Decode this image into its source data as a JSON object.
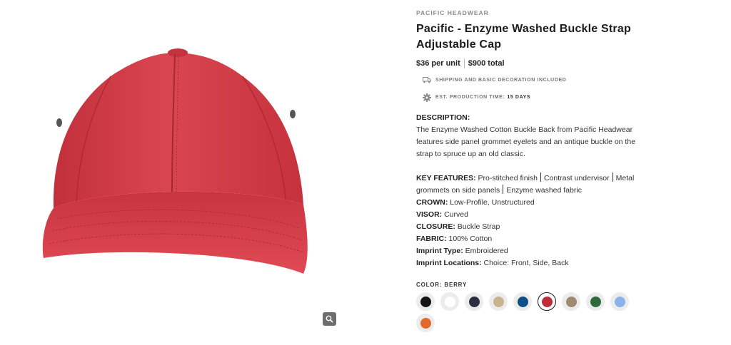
{
  "product": {
    "brand": "PACIFIC HEADWEAR",
    "title": "Pacific - Enzyme Washed Buckle Strap Adjustable Cap",
    "price_per_unit": "$36 per unit",
    "price_total": "$900 total",
    "shipping_note": "SHIPPING AND BASIC DECORATION INCLUDED",
    "production_label": "EST. PRODUCTION TIME:",
    "production_value": "15 DAYS"
  },
  "description": {
    "heading": "DESCRIPTION:",
    "text": "The Enzyme Washed Cotton Buckle Back from Pacific Headwear features side panel grommet eyelets and an antique buckle on the strap to spruce up an old classic."
  },
  "specs": {
    "key_features_label": "KEY FEATURES:",
    "key_features": [
      "Pro-stitched finish",
      "Contrast undervisor",
      "Metal grommets on side panels",
      "Enzyme washed fabric"
    ],
    "crown_label": "CROWN:",
    "crown": "Low-Profile, Unstructured",
    "visor_label": "VISOR:",
    "visor": "Curved",
    "closure_label": "CLOSURE:",
    "closure": "Buckle Strap",
    "fabric_label": "FABRIC:",
    "fabric": "100% Cotton",
    "imprint_type_label": "Imprint Type:",
    "imprint_type": "Embroidered",
    "imprint_locations_label": "Imprint Locations:",
    "imprint_locations": "Choice: Front, Side, Back"
  },
  "colors": {
    "label": "COLOR: BERRY",
    "selected_index": 4,
    "swatches": [
      {
        "name": "black",
        "hex": "#141414"
      },
      {
        "name": "white",
        "hex": "#ffffff"
      },
      {
        "name": "navy",
        "hex": "#2b2f3f"
      },
      {
        "name": "khaki",
        "hex": "#c8b38f"
      },
      {
        "name": "berry",
        "hex": "#bf2b39"
      },
      {
        "name": "royal",
        "hex": "#0f4f86"
      },
      {
        "name": "stone",
        "hex": "#9e8a72"
      },
      {
        "name": "green",
        "hex": "#2f6b3a"
      },
      {
        "name": "light-blue",
        "hex": "#8ab3ea"
      },
      {
        "name": "orange",
        "hex": "#e2692a"
      }
    ],
    "order": [
      0,
      1,
      2,
      3,
      5,
      4,
      6,
      7,
      8,
      9
    ]
  },
  "image": {
    "product_color": "#d23a44",
    "zoom_icon": "magnifier-icon"
  }
}
